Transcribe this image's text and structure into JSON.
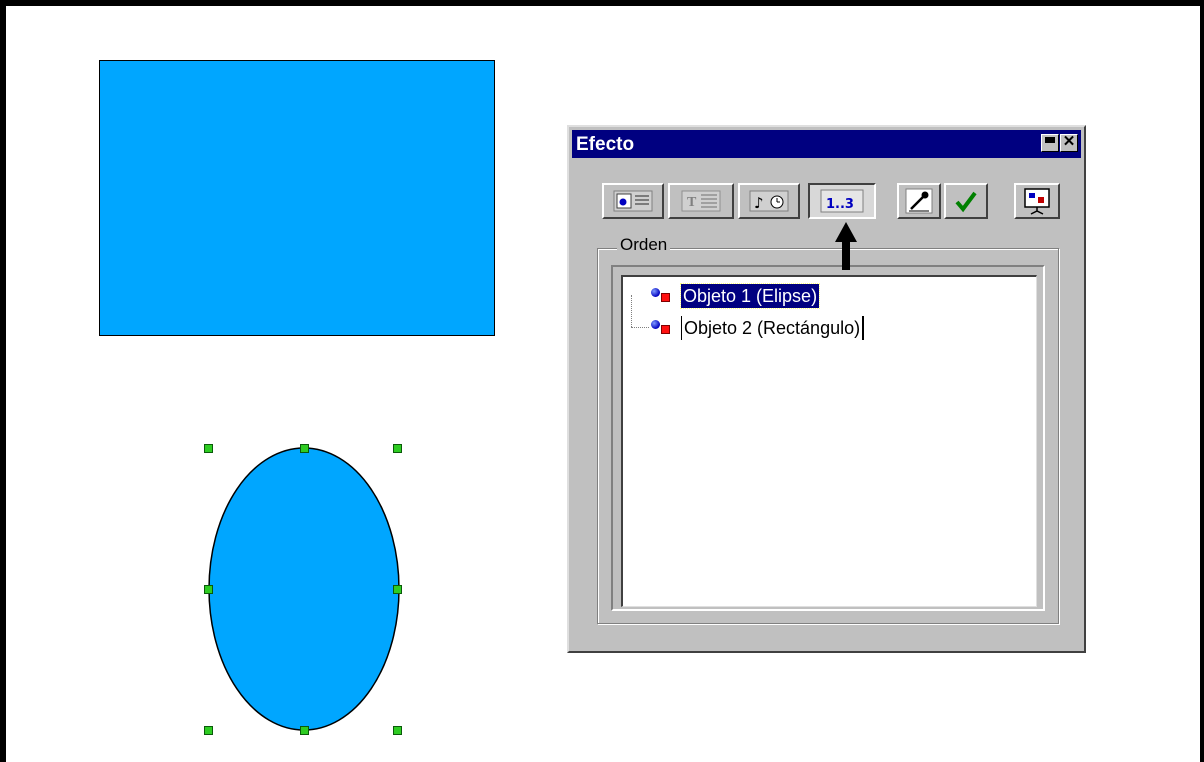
{
  "dialog": {
    "title": "Efecto",
    "group_label": "Orden",
    "items": [
      {
        "label": "Objeto 1 (Elipse)",
        "selected": true
      },
      {
        "label": "Objeto 2 (Rectángulo)",
        "selected": false
      }
    ],
    "toolbar": [
      {
        "name": "effects-icon"
      },
      {
        "name": "text-effects-icon"
      },
      {
        "name": "extras-icon"
      },
      {
        "name": "order-icon",
        "text": "1..3",
        "pressed": true
      },
      {
        "name": "pipette-icon"
      },
      {
        "name": "assign-checkmark-icon"
      },
      {
        "name": "preview-icon"
      }
    ]
  },
  "colors": {
    "shape_fill": "#00a6ff",
    "handle": "#2ecc22",
    "titlebar": "#000080",
    "dialog_bg": "#c0c0c0"
  }
}
